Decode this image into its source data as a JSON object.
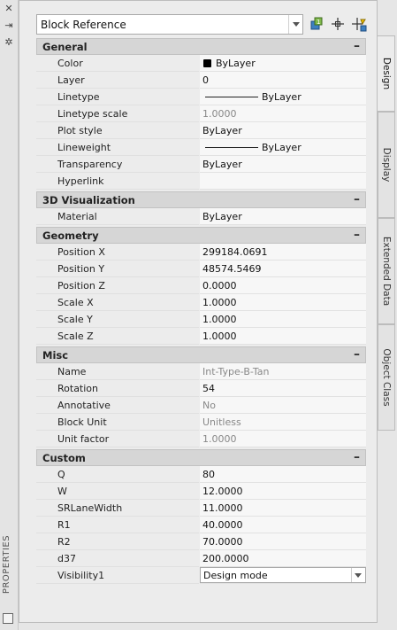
{
  "strip": {
    "title": "PROPERTIES",
    "icons": [
      "close-icon",
      "auto-hide-icon",
      "settings-icon"
    ],
    "icon_glyphs": [
      "✕",
      "⇥",
      "✲"
    ]
  },
  "selector": {
    "value": "Block Reference"
  },
  "toolbar": {
    "buttons": [
      "toggle-pickadd-icon",
      "select-objects-icon",
      "quick-select-icon"
    ]
  },
  "sections": [
    {
      "title": "General",
      "toggle": "–",
      "rows": [
        {
          "name": "Color",
          "value": "ByLayer",
          "swatch": "#000000"
        },
        {
          "name": "Layer",
          "value": "0"
        },
        {
          "name": "Linetype",
          "value": "ByLayer",
          "line": true
        },
        {
          "name": "Linetype scale",
          "value": "1.0000",
          "gray": true
        },
        {
          "name": "Plot style",
          "value": "ByLayer"
        },
        {
          "name": "Lineweight",
          "value": "ByLayer",
          "line": true
        },
        {
          "name": "Transparency",
          "value": "ByLayer"
        },
        {
          "name": "Hyperlink",
          "value": ""
        }
      ]
    },
    {
      "title": "3D Visualization",
      "toggle": "–",
      "rows": [
        {
          "name": "Material",
          "value": "ByLayer"
        }
      ]
    },
    {
      "title": "Geometry",
      "toggle": "–",
      "rows": [
        {
          "name": "Position X",
          "value": "299184.0691"
        },
        {
          "name": "Position Y",
          "value": "48574.5469"
        },
        {
          "name": "Position Z",
          "value": "0.0000"
        },
        {
          "name": "Scale X",
          "value": "1.0000"
        },
        {
          "name": "Scale Y",
          "value": "1.0000"
        },
        {
          "name": "Scale Z",
          "value": "1.0000"
        }
      ]
    },
    {
      "title": "Misc",
      "toggle": "–",
      "rows": [
        {
          "name": "Name",
          "value": "Int-Type-B-Tan",
          "gray": true
        },
        {
          "name": "Rotation",
          "value": "54"
        },
        {
          "name": "Annotative",
          "value": "No",
          "gray": true
        },
        {
          "name": "Block Unit",
          "value": "Unitless",
          "gray": true
        },
        {
          "name": "Unit factor",
          "value": "1.0000",
          "gray": true
        }
      ]
    },
    {
      "title": "Custom",
      "toggle": "–",
      "rows": [
        {
          "name": "Q",
          "value": "80"
        },
        {
          "name": "W",
          "value": "12.0000"
        },
        {
          "name": "SRLaneWidth",
          "value": "11.0000"
        },
        {
          "name": "R1",
          "value": "40.0000"
        },
        {
          "name": "R2",
          "value": "70.0000"
        },
        {
          "name": "d37",
          "value": "200.0000"
        },
        {
          "name": "Visibility1",
          "value": "Design mode",
          "dropdown": true
        }
      ]
    }
  ],
  "tabs": [
    {
      "label": "Design",
      "active": true
    },
    {
      "label": "Display",
      "active": false
    },
    {
      "label": "Extended Data",
      "active": false
    },
    {
      "label": "Object Class",
      "active": false
    }
  ],
  "colors": {
    "header": "#d6d6d6",
    "value_bg": "#f7f7f7",
    "disabled_text": "#888888"
  }
}
